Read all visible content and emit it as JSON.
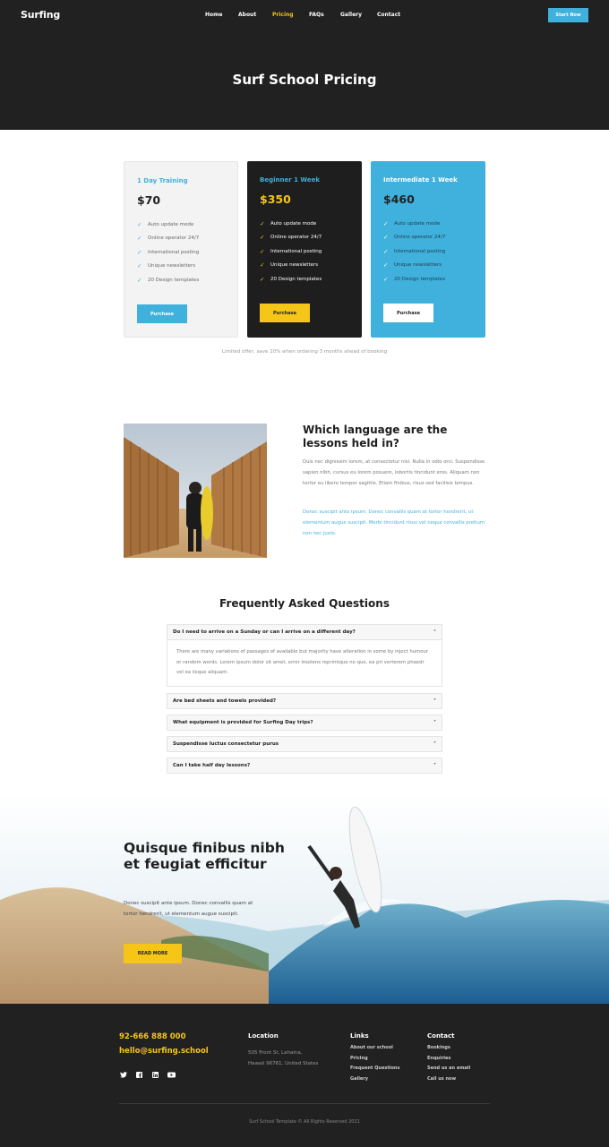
{
  "header": {
    "logo_text": "Surfing",
    "nav": [
      {
        "label": "Home"
      },
      {
        "label": "About"
      },
      {
        "label": "Pricing"
      },
      {
        "label": "FAQs"
      },
      {
        "label": "Gallery"
      },
      {
        "label": "Contact"
      }
    ],
    "cta_label": "Start Now",
    "page_title": "Surf School Pricing"
  },
  "pricing": {
    "plans": [
      {
        "name": "1 Day Training",
        "price": "$70",
        "features": [
          "Auto update mode",
          "Online operator 24/7",
          "International posting",
          "Unique newsletters",
          "20 Design templates"
        ],
        "button": "Purchase"
      },
      {
        "name": "Beginner 1 Week",
        "price": "$350",
        "features": [
          "Auto update mode",
          "Online operator 24/7",
          "International posting",
          "Unique newsletters",
          "20 Design templates"
        ],
        "button": "Purchase"
      },
      {
        "name": "Intermediate 1 Week",
        "price": "$460",
        "features": [
          "Auto update mode",
          "Online operator 24/7",
          "International posting",
          "Unique newsletters",
          "20 Design templates"
        ],
        "button": "Purchase"
      }
    ],
    "note": "Limited offer, save 20% when ordering 3 months ahead of booking"
  },
  "language": {
    "title": "Which language are the lessons held in?",
    "p1": "Duis nec dignissim lorem, at consectetur nisi. Nulla in odio orci. Suspendisse sapien nibh, cursus eu lorem posuere, lobortis tincidunt eros. Aliquam non tortor eu libero tempor sagittis. Etiam finibus, risus sed facilisis tempus.",
    "p2": "Donec suscipit ante ipsum. Donec convallis quam at tortor hendrerit, ut elementum augue suscipit. Morbi tincidunt risus vel neque convallis pretium non nec justo."
  },
  "faq": {
    "title": "Frequently Asked Questions",
    "items": [
      {
        "q": "Do I need to arrive on a Sunday or can I arrive on a different day?",
        "a": "There are many variations of passages of available but majority have alteration in some by inject humour or random words. Lorem ipsum dolor sit amet, error insolens reprimique no quo, ea pri verterem phaedr vel ea iisque aliquam."
      },
      {
        "q": "Are bed sheets and towels provided?"
      },
      {
        "q": "What equipment is provided for Surfing Day trips?"
      },
      {
        "q": "Suspendisse luctus consectetur purus"
      },
      {
        "q": "Can I take half day lessons?"
      }
    ]
  },
  "banner": {
    "title": "Quisque finibus nibh et feugiat efficitur",
    "text": "Donec suscipit ante ipsum. Donec convallis quam at tortor hendrerit, ut elementum augue suscipit.",
    "button": "READ MORE"
  },
  "footer": {
    "phone": "92-666 888 000",
    "email": "hello@surfing.school",
    "social": [
      "twitter-icon",
      "facebook-icon",
      "linkedin-icon",
      "youtube-icon"
    ],
    "location_head": "Location",
    "address_line1": "505 Front St, Lahaina,",
    "address_line2": "Hawaii 96761, United States",
    "links_head": "Links",
    "links": [
      "About our school",
      "Pricing",
      "Frequent Questions",
      "Gallery"
    ],
    "contact_head": "Contact",
    "contact_links": [
      "Bookings",
      "Enquiries",
      "Send us an email",
      "Call us now"
    ],
    "copyright": "Surf School Template  © All Rights Reserved 2021"
  },
  "colors": {
    "dark": "#212121",
    "accent_blue": "#3fb1dc",
    "accent_yellow": "#f5c518"
  }
}
